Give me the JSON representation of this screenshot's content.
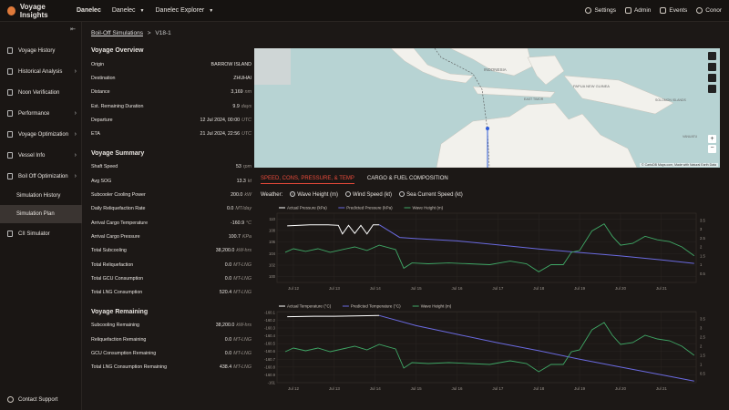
{
  "topbar": {
    "brand": "Voyage Insights",
    "company": "Danelec",
    "org_select": "Danelec",
    "explorer_select": "Danelec Explorer",
    "settings": "Settings",
    "admin": "Admin",
    "events": "Events",
    "user": "Conor"
  },
  "sidebar": {
    "items": [
      {
        "label": "Voyage History",
        "chevron": false
      },
      {
        "label": "Historical Analysis",
        "chevron": true
      },
      {
        "label": "Noon Verification",
        "chevron": false
      },
      {
        "label": "Performance",
        "chevron": true
      },
      {
        "label": "Voyage Optimization",
        "chevron": true
      },
      {
        "label": "Vessel Info",
        "chevron": true
      },
      {
        "label": "Boil Off Optimization",
        "chevron": true
      }
    ],
    "subitems": [
      "Simulation History",
      "Simulation Plan"
    ],
    "after": [
      "CII Simulator"
    ],
    "contact": "Contact Support"
  },
  "breadcrumb": {
    "parent": "Boil-Off Simulations",
    "sep": ">",
    "current": "V18-1"
  },
  "overview": {
    "title": "Voyage Overview",
    "rows": [
      {
        "label": "Origin",
        "value": "BARROW ISLAND",
        "unit": ""
      },
      {
        "label": "Destination",
        "value": "ZHUHAI",
        "unit": ""
      },
      {
        "label": "Distance",
        "value": "3,169",
        "unit": "nm"
      },
      {
        "label": "Est. Remaining Duration",
        "value": "9.9",
        "unit": "days"
      },
      {
        "label": "Departure",
        "value": "12 Jul 2024, 00:00",
        "unit": "UTC"
      },
      {
        "label": "ETA",
        "value": "21 Jul 2024, 22:56",
        "unit": "UTC"
      }
    ]
  },
  "summary": {
    "title": "Voyage Summary",
    "rows": [
      {
        "label": "Shaft Speed",
        "value": "53",
        "unit": "rpm"
      },
      {
        "label": "Avg SOG",
        "value": "13.3",
        "unit": "kt"
      },
      {
        "label": "Subcooler Cooling Power",
        "value": "200.0",
        "unit": "kW"
      },
      {
        "label": "Daily Reliquefaction Rate",
        "value": "0.0",
        "unit": "MT/day"
      },
      {
        "label": "Arrival Cargo Temperature",
        "value": "-160.9",
        "unit": "°C"
      },
      {
        "label": "Arrival Cargo Pressure",
        "value": "100.7",
        "unit": "KPa"
      },
      {
        "label": "Total Subcooling",
        "value": "38,200.0",
        "unit": "kW-hrs"
      },
      {
        "label": "Total Reliquefaction",
        "value": "0.0",
        "unit": "MT-LNG"
      },
      {
        "label": "Total GCU Consumption",
        "value": "0.0",
        "unit": "MT-LNG"
      },
      {
        "label": "Total LNG Consumption",
        "value": "520.4",
        "unit": "MT-LNG"
      }
    ]
  },
  "remaining": {
    "title": "Voyage Remaining",
    "rows": [
      {
        "label": "Subcooling Remaining",
        "value": "38,200.0",
        "unit": "kW-hrs"
      },
      {
        "label": "Reliquefaction Remaining",
        "value": "0.0",
        "unit": "MT-LNG"
      },
      {
        "label": "GCU Consumption Remaining",
        "value": "0.0",
        "unit": "MT-LNG"
      },
      {
        "label": "Total LNG Consumption Remaining",
        "value": "438.4",
        "unit": "MT-LNG"
      }
    ]
  },
  "map": {
    "labels": [
      "INDONESIA",
      "PAPUA NEW GUINEA",
      "EAST TIMOR",
      "SOLOMON ISLANDS",
      "VANUATU"
    ],
    "attribution": "© CartoDB Maps.com, Made with Natural Earth Data",
    "colors": {
      "water": "#b7d3d3",
      "land": "#f2f1ec",
      "route": "#2f5bd8"
    }
  },
  "tabs": [
    {
      "label": "SPEED, CONS, PRESSURE, & TEMP",
      "active": true
    },
    {
      "label": "CARGO & FUEL COMPOSITION",
      "active": false
    }
  ],
  "weather": {
    "label": "Weather:",
    "options": [
      {
        "label": "Wave Height (m)",
        "selected": true
      },
      {
        "label": "Wind Speed (kt)",
        "selected": false
      },
      {
        "label": "Sea Current Speed (kt)",
        "selected": false
      }
    ]
  },
  "chart_data": [
    {
      "type": "line",
      "legend": [
        "Actual Pressure (kPa)",
        "Predicted Pressure (kPa)",
        "Wave Height (m)"
      ],
      "x_ticks": [
        "Jul 12",
        "Jul 13",
        "Jul 14",
        "Jul 15",
        "Jul 16",
        "Jul 17",
        "Jul 18",
        "Jul 19",
        "Jul 20",
        "Jul 21"
      ],
      "x_range": [
        11.6,
        21.85
      ],
      "y_left": {
        "range": [
          99,
          111
        ],
        "ticks": [
          100,
          102,
          104,
          106,
          108,
          110
        ]
      },
      "y_right": {
        "range": [
          0,
          3.9
        ],
        "ticks": [
          0.5,
          1.0,
          1.5,
          2.0,
          2.5,
          3.0,
          3.5
        ]
      },
      "series": [
        {
          "name": "Actual Pressure (kPa)",
          "axis": "left",
          "color": "#ffffff",
          "x": [
            11.85,
            12.4,
            12.85,
            13.1,
            13.2,
            13.35,
            13.5,
            13.65,
            13.8,
            13.95,
            14.1
          ],
          "y": [
            108.8,
            109.0,
            109.0,
            108.9,
            107.4,
            108.9,
            107.5,
            108.9,
            107.4,
            109.0,
            109.0
          ]
        },
        {
          "name": "Predicted Pressure (kPa)",
          "axis": "left",
          "color": "#6a6ae0",
          "x": [
            14.1,
            14.6,
            15.0,
            16.0,
            17.0,
            18.0,
            19.0,
            20.0,
            21.0,
            21.8
          ],
          "y": [
            109.0,
            106.8,
            106.6,
            106.2,
            105.5,
            104.8,
            104.2,
            103.6,
            102.9,
            102.3
          ]
        },
        {
          "name": "Wave Height (m)",
          "axis": "right",
          "color": "#3fa866",
          "x": [
            11.8,
            12.0,
            12.3,
            12.6,
            12.9,
            13.2,
            13.5,
            13.8,
            14.1,
            14.5,
            14.7,
            14.9,
            15.3,
            15.8,
            16.3,
            16.8,
            17.3,
            17.7,
            18.0,
            18.3,
            18.6,
            18.8,
            19.0,
            19.3,
            19.6,
            19.8,
            20.0,
            20.3,
            20.6,
            20.9,
            21.2,
            21.5,
            21.8
          ],
          "y": [
            1.7,
            1.9,
            1.75,
            1.9,
            1.7,
            1.85,
            2.0,
            1.8,
            2.1,
            1.85,
            0.8,
            1.1,
            1.05,
            1.1,
            1.05,
            1.0,
            1.2,
            1.05,
            0.6,
            1.0,
            1.0,
            1.7,
            1.8,
            2.9,
            3.3,
            2.6,
            2.1,
            2.2,
            2.6,
            2.4,
            2.3,
            2.0,
            1.5
          ]
        }
      ]
    },
    {
      "type": "line",
      "legend": [
        "Actual Temperature (°C)",
        "Predicted Temperature (°C)",
        "Wave Height (m)"
      ],
      "x_ticks": [
        "Jul 12",
        "Jul 13",
        "Jul 14",
        "Jul 15",
        "Jul 16",
        "Jul 17",
        "Jul 18",
        "Jul 19",
        "Jul 20",
        "Jul 21"
      ],
      "x_range": [
        11.6,
        21.85
      ],
      "y_left": {
        "range": [
          -161.0,
          -160.09
        ],
        "ticks": [
          -160.1,
          -160.2,
          -160.3,
          -160.4,
          -160.5,
          -160.6,
          -160.7,
          -160.8,
          -160.9,
          -161.0
        ]
      },
      "y_right": {
        "range": [
          0,
          3.9
        ],
        "ticks": [
          0.5,
          1.0,
          1.5,
          2.0,
          2.5,
          3.0,
          3.5
        ]
      },
      "series": [
        {
          "name": "Actual Temperature (°C)",
          "axis": "left",
          "color": "#ffffff",
          "x": [
            11.85,
            12.5,
            13.0,
            13.5,
            14.1
          ],
          "y": [
            -160.155,
            -160.15,
            -160.15,
            -160.145,
            -160.14
          ]
        },
        {
          "name": "Predicted Temperature (°C)",
          "axis": "left",
          "color": "#6a6ae0",
          "x": [
            14.1,
            15.0,
            16.0,
            17.0,
            18.0,
            19.0,
            20.0,
            21.0,
            21.8
          ],
          "y": [
            -160.14,
            -160.27,
            -160.38,
            -160.49,
            -160.59,
            -160.7,
            -160.8,
            -160.9,
            -160.98
          ]
        },
        {
          "name": "Wave Height (m)",
          "axis": "right",
          "color": "#3fa866",
          "x": [
            11.8,
            12.0,
            12.3,
            12.6,
            12.9,
            13.2,
            13.5,
            13.8,
            14.1,
            14.5,
            14.7,
            14.9,
            15.3,
            15.8,
            16.3,
            16.8,
            17.3,
            17.7,
            18.0,
            18.3,
            18.6,
            18.8,
            19.0,
            19.3,
            19.6,
            19.8,
            20.0,
            20.3,
            20.6,
            20.9,
            21.2,
            21.5,
            21.8
          ],
          "y": [
            1.7,
            1.9,
            1.75,
            1.9,
            1.7,
            1.85,
            2.0,
            1.8,
            2.1,
            1.85,
            0.8,
            1.1,
            1.05,
            1.1,
            1.05,
            1.0,
            1.2,
            1.05,
            0.6,
            1.0,
            1.0,
            1.7,
            1.8,
            2.9,
            3.3,
            2.6,
            2.1,
            2.2,
            2.6,
            2.4,
            2.3,
            2.0,
            1.5
          ]
        }
      ]
    }
  ]
}
